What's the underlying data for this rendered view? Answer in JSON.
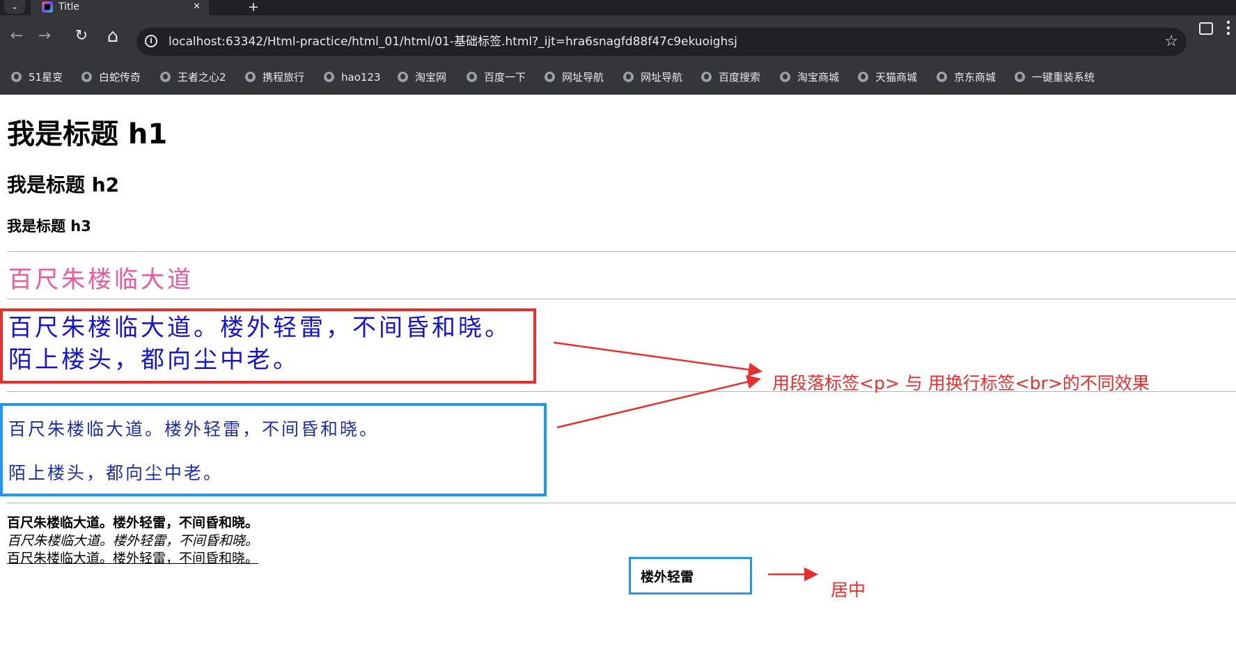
{
  "browser": {
    "tab_title": "Title",
    "tab_close": "✕",
    "new_tab": "+",
    "tab_menu": "⌄",
    "back": "←",
    "forward": "→",
    "reload": "↻",
    "home": "⌂",
    "url": "localhost:63342/Html-practice/html_01/html/01-基础标签.html?_ijt=hra6snagfd88f47c9ekuoighsj",
    "star": "☆",
    "bookmarks": [
      "51星变",
      "白蛇传奇",
      "王者之心2",
      "携程旅行",
      "hao123",
      "淘宝网",
      "百度一下",
      "网址导航",
      "网址导航",
      "百度搜索",
      "淘宝商城",
      "天猫商城",
      "京东商城",
      "一键重装系统"
    ]
  },
  "page": {
    "h1": "我是标题 h1",
    "h2": "我是标题 h2",
    "h3": "我是标题 h3",
    "pink_line": "百尺朱楼临大道",
    "br_line1": "百尺朱楼临大道。楼外轻雷，不间昏和晓。",
    "br_line2": "陌上楼头，都向尘中老。",
    "p_line1": "百尺朱楼临大道。楼外轻雷，不间昏和晓。",
    "p_line2": "陌上楼头，都向尘中老。",
    "bold_line": "百尺朱楼临大道。楼外轻雷，不间昏和晓。",
    "italic_line": "百尺朱楼临大道。楼外轻雷，不间昏和晓。",
    "underline_line": "百尺朱楼临大道。楼外轻雷，不间昏和晓。",
    "center_box_text": "楼外轻雷"
  },
  "annotations": {
    "compare_label": "用段落标签<p> 与 用换行标签<br>的不同效果",
    "center_label": "居中",
    "color": "#ea2e2e"
  },
  "colors": {
    "pink_text": "#ea5a9d",
    "blue_text": "#1414d2",
    "red_box": "#ea2e2e",
    "blue_box": "#2196f3"
  },
  "icons": {
    "info": "info-icon",
    "star": "bookmark-star-icon",
    "extensions": "extensions-icon",
    "menu": "kebab-menu-icon",
    "bookmark": "globe-icon"
  }
}
